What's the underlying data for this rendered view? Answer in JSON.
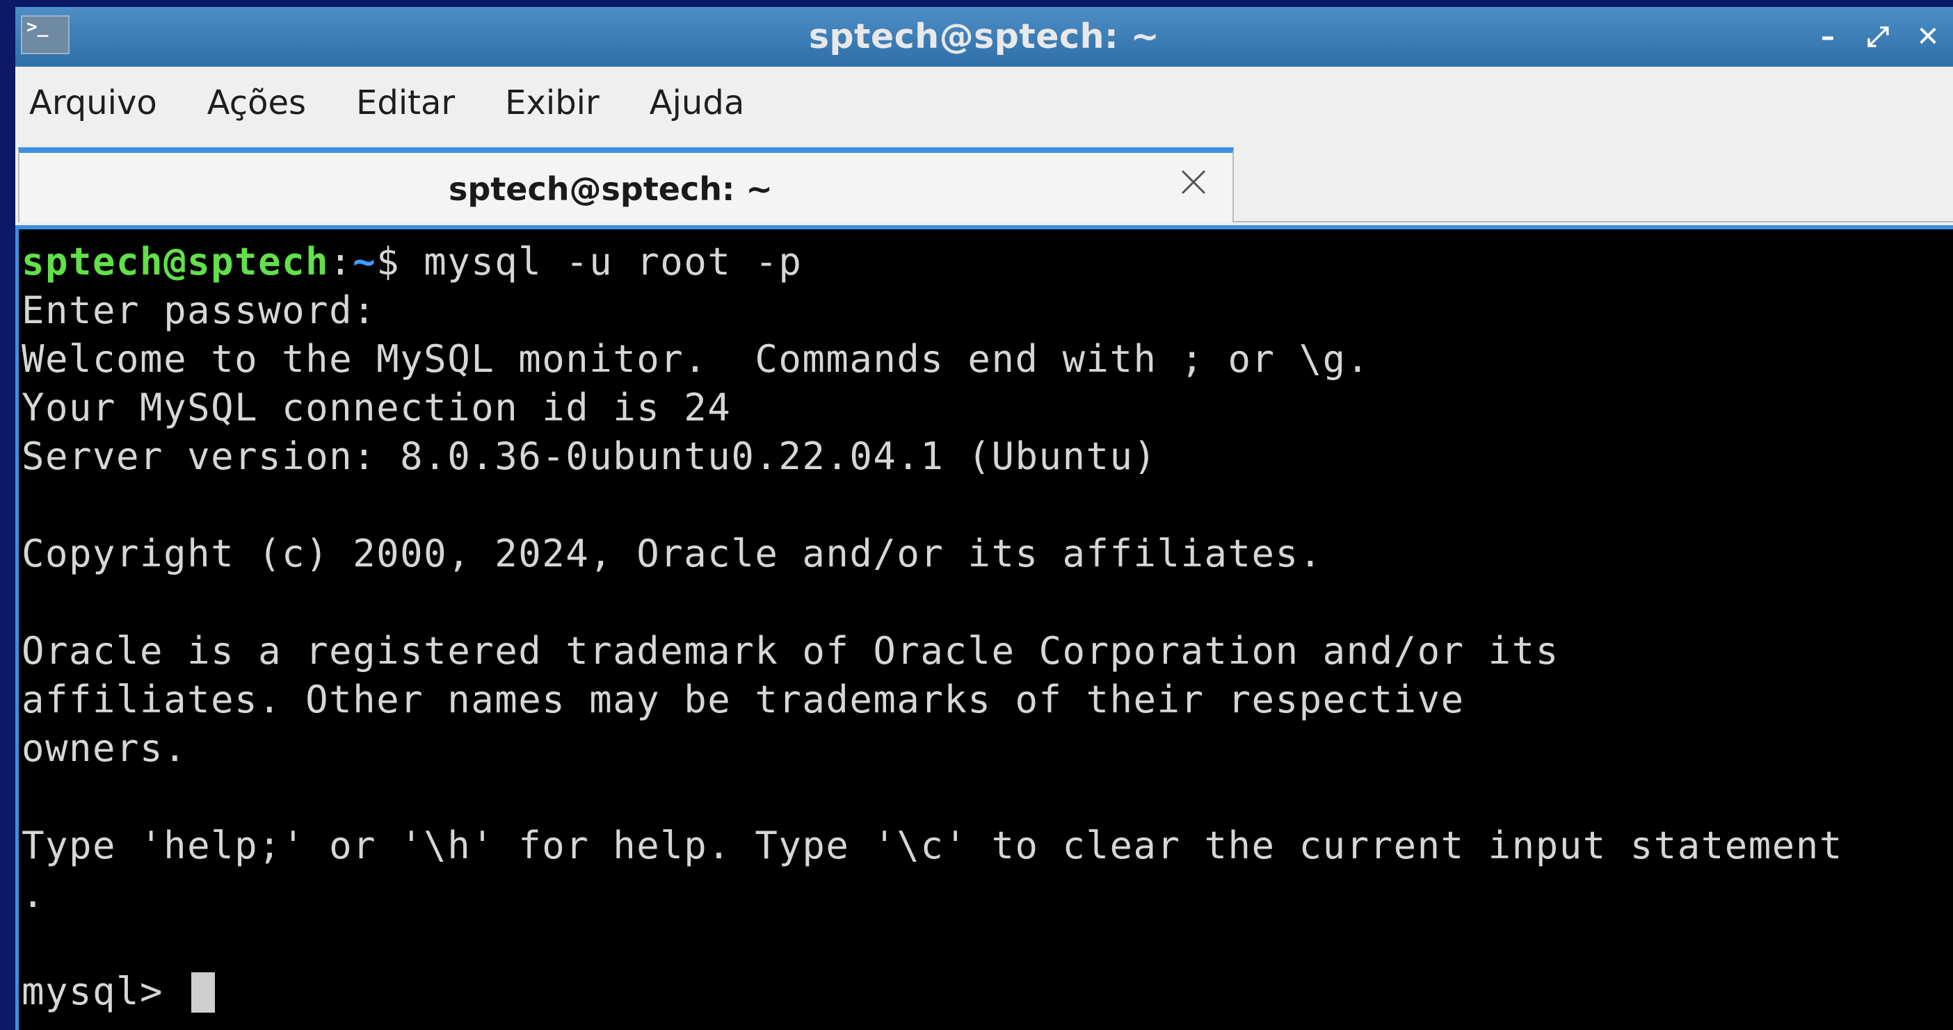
{
  "window": {
    "title": "sptech@sptech: ~",
    "app_icon_glyph": ">_",
    "controls": {
      "minimize": "–",
      "maximize": "⤢",
      "close": "✕"
    }
  },
  "menubar": {
    "items": [
      {
        "label": "Arquivo"
      },
      {
        "label": "Ações"
      },
      {
        "label": "Editar"
      },
      {
        "label": "Exibir"
      },
      {
        "label": "Ajuda"
      }
    ]
  },
  "tabs": [
    {
      "label": "sptech@sptech: ~",
      "active": true
    }
  ],
  "terminal": {
    "prompt": {
      "user_host": "sptech@sptech",
      "separator": ":",
      "path": "~",
      "symbol": "$ ",
      "command": "mysql -u root -p"
    },
    "output": [
      "Enter password:",
      "Welcome to the MySQL monitor.  Commands end with ; or \\g.",
      "Your MySQL connection id is 24",
      "Server version: 8.0.36-0ubuntu0.22.04.1 (Ubuntu)",
      "",
      "Copyright (c) 2000, 2024, Oracle and/or its affiliates.",
      "",
      "Oracle is a registered trademark of Oracle Corporation and/or its",
      "affiliates. Other names may be trademarks of their respective",
      "owners.",
      "",
      "Type 'help;' or '\\h' for help. Type '\\c' to clear the current input statement",
      ".",
      ""
    ],
    "mysql_prompt": "mysql> "
  },
  "colors": {
    "desktop_bg": "#0b1a66",
    "titlebar": "#3a7db8",
    "accent": "#3d8fe0",
    "prompt_user": "#62e04a",
    "prompt_path": "#3c9cff",
    "terminal_bg": "#000000",
    "terminal_fg": "#d6d6d6"
  }
}
